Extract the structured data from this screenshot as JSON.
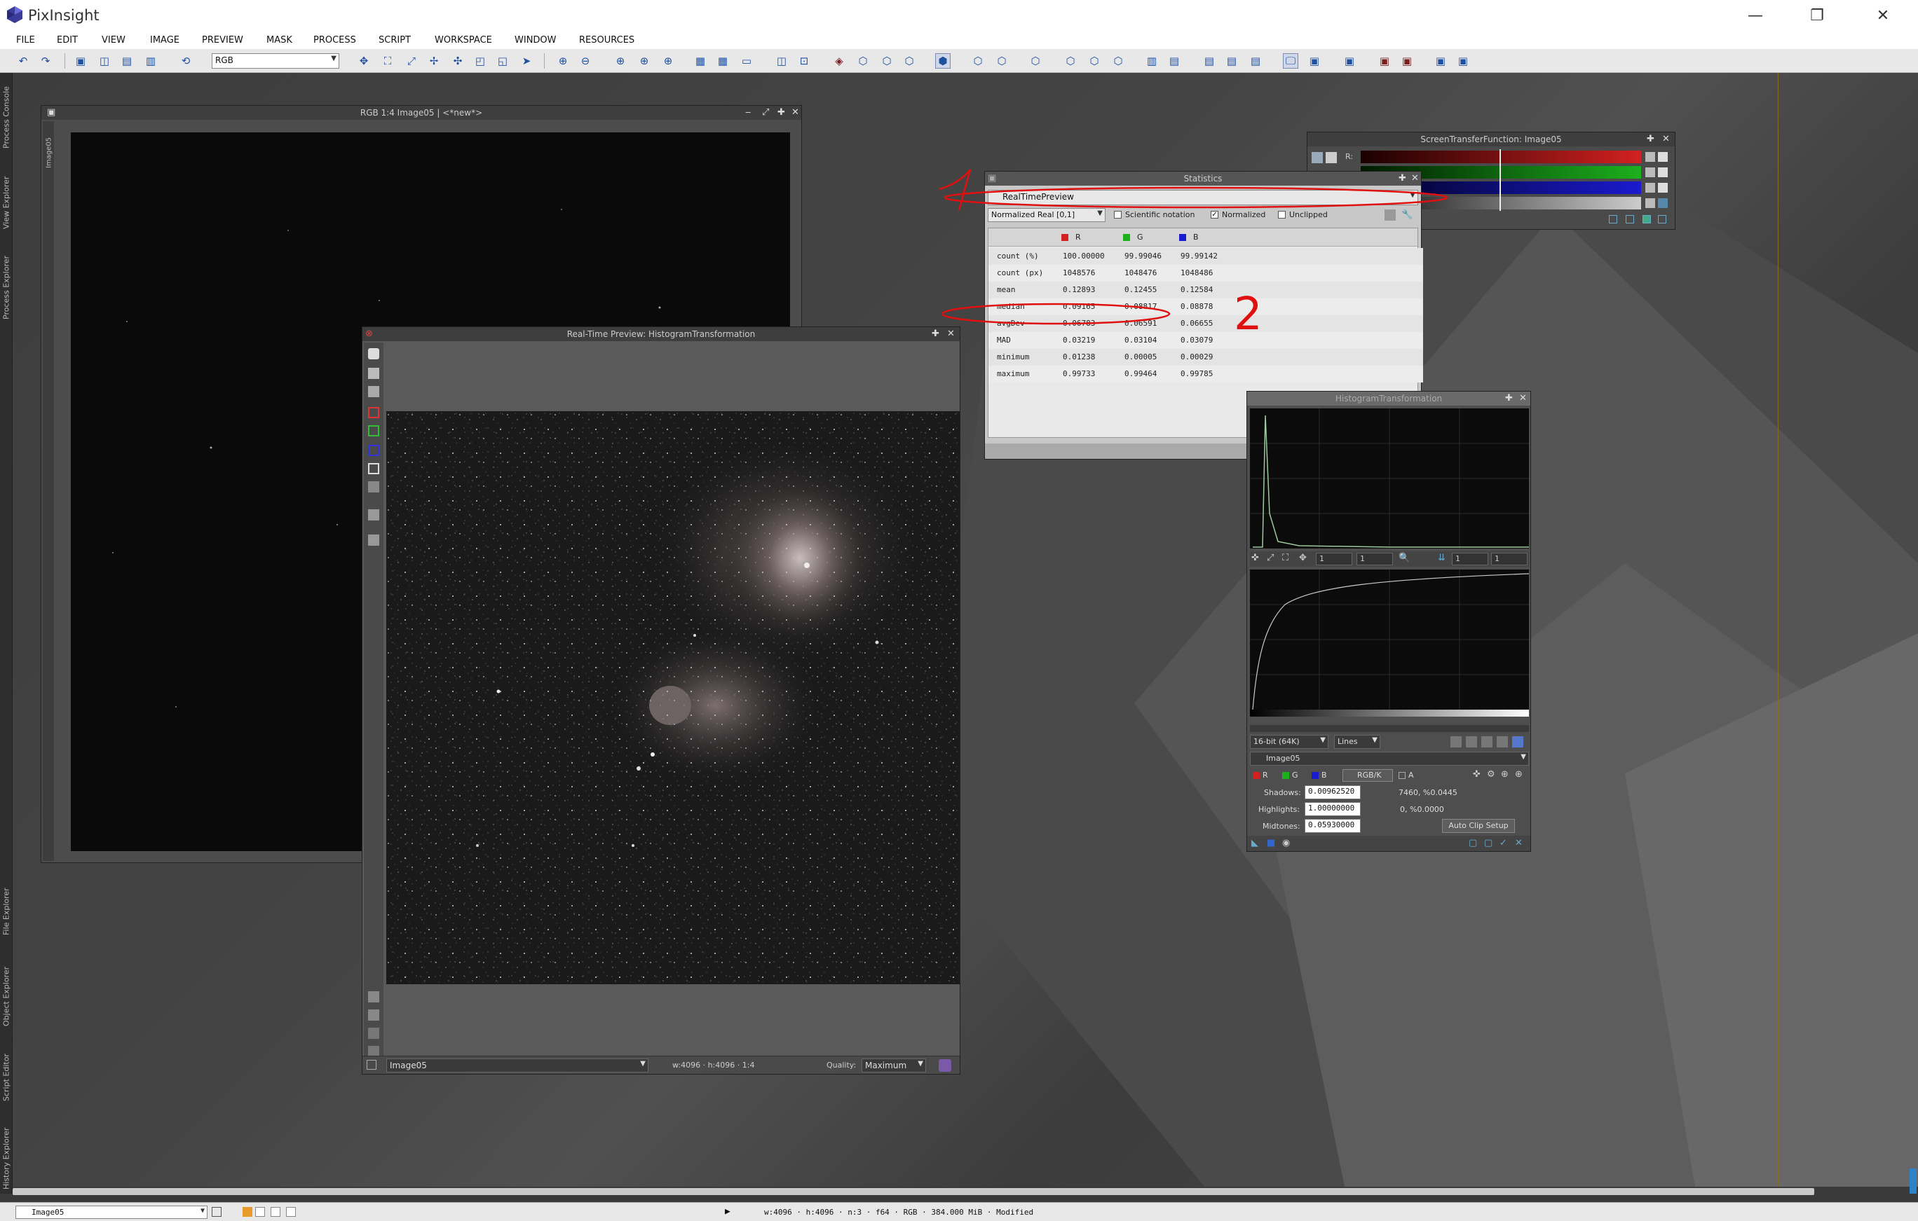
{
  "app": {
    "title": "PixInsight"
  },
  "menu": [
    "FILE",
    "EDIT",
    "VIEW",
    "IMAGE",
    "PREVIEW",
    "MASK",
    "PROCESS",
    "SCRIPT",
    "WORKSPACE",
    "WINDOW",
    "RESOURCES"
  ],
  "toolbar": {
    "channel_combo": "RGB"
  },
  "side_tabs": [
    "Process Console",
    "View Explorer",
    "Process Explorer",
    "File Explorer",
    "Object Explorer",
    "Script Editor",
    "History Explorer"
  ],
  "image_window": {
    "title": "RGB 1:4 Image05 | <*new*>",
    "side_label": "Image05"
  },
  "preview_window": {
    "title": "Real-Time Preview: HistogramTransformation",
    "view_combo": "Image05",
    "dims": "w:4096 · h:4096 · 1:4",
    "quality_label": "Quality:",
    "quality_value": "Maximum"
  },
  "statistics": {
    "title": "Statistics",
    "view_combo": "RealTimePreview",
    "range_combo": "Normalized Real [0,1]",
    "opt_scientific": "Scientific notation",
    "opt_normalized": "Normalized",
    "opt_unclipped": "Unclipped",
    "columns": [
      "R",
      "G",
      "B"
    ],
    "rows": [
      {
        "label": "count (%)",
        "r": "100.00000",
        "g": "99.99046",
        "b": "99.99142"
      },
      {
        "label": "count (px)",
        "r": "1048576",
        "g": "1048476",
        "b": "1048486"
      },
      {
        "label": "mean",
        "r": "0.12893",
        "g": "0.12455",
        "b": "0.12584"
      },
      {
        "label": "median",
        "r": "0.09165",
        "g": "0.08817",
        "b": "0.08878"
      },
      {
        "label": "avgDev",
        "r": "0.06783",
        "g": "0.06591",
        "b": "0.06655"
      },
      {
        "label": "MAD",
        "r": "0.03219",
        "g": "0.03104",
        "b": "0.03079"
      },
      {
        "label": "minimum",
        "r": "0.01238",
        "g": "0.00005",
        "b": "0.00029"
      },
      {
        "label": "maximum",
        "r": "0.99733",
        "g": "0.99464",
        "b": "0.99785"
      }
    ],
    "annotation_1": "1",
    "annotation_2": "2"
  },
  "stf": {
    "title": "ScreenTransferFunction: Image05",
    "r_label": "R:"
  },
  "histogram": {
    "title": "HistogramTransformation",
    "zoom_h": "1",
    "zoom_v": "1",
    "zoom_h2": "1",
    "zoom_v2": "1",
    "resolution": "16-bit (64K)",
    "graph_style": "Lines",
    "view": "Image05",
    "ch_r": "R",
    "ch_g": "G",
    "ch_b": "B",
    "ch_rgbk": "RGB/K",
    "ch_a": "A",
    "shadows_label": "Shadows:",
    "shadows_value": "0.00962520",
    "shadows_clip": "7460, %0.0445",
    "highlights_label": "Highlights:",
    "highlights_value": "1.00000000",
    "highlights_clip": "0, %0.0000",
    "midtones_label": "Midtones:",
    "midtones_value": "0.05930000",
    "auto_clip": "Auto Clip Setup"
  },
  "statusbar": {
    "view_combo": "Image05",
    "info": "w:4096 · h:4096 · n:3 · f64 · RGB · 384.000 MiB · Modified"
  },
  "colors": {
    "accent_red": "#d32020",
    "annotation": "#e01010",
    "stf_green": "#1cb01c",
    "stf_blue": "#1a1ad0"
  }
}
